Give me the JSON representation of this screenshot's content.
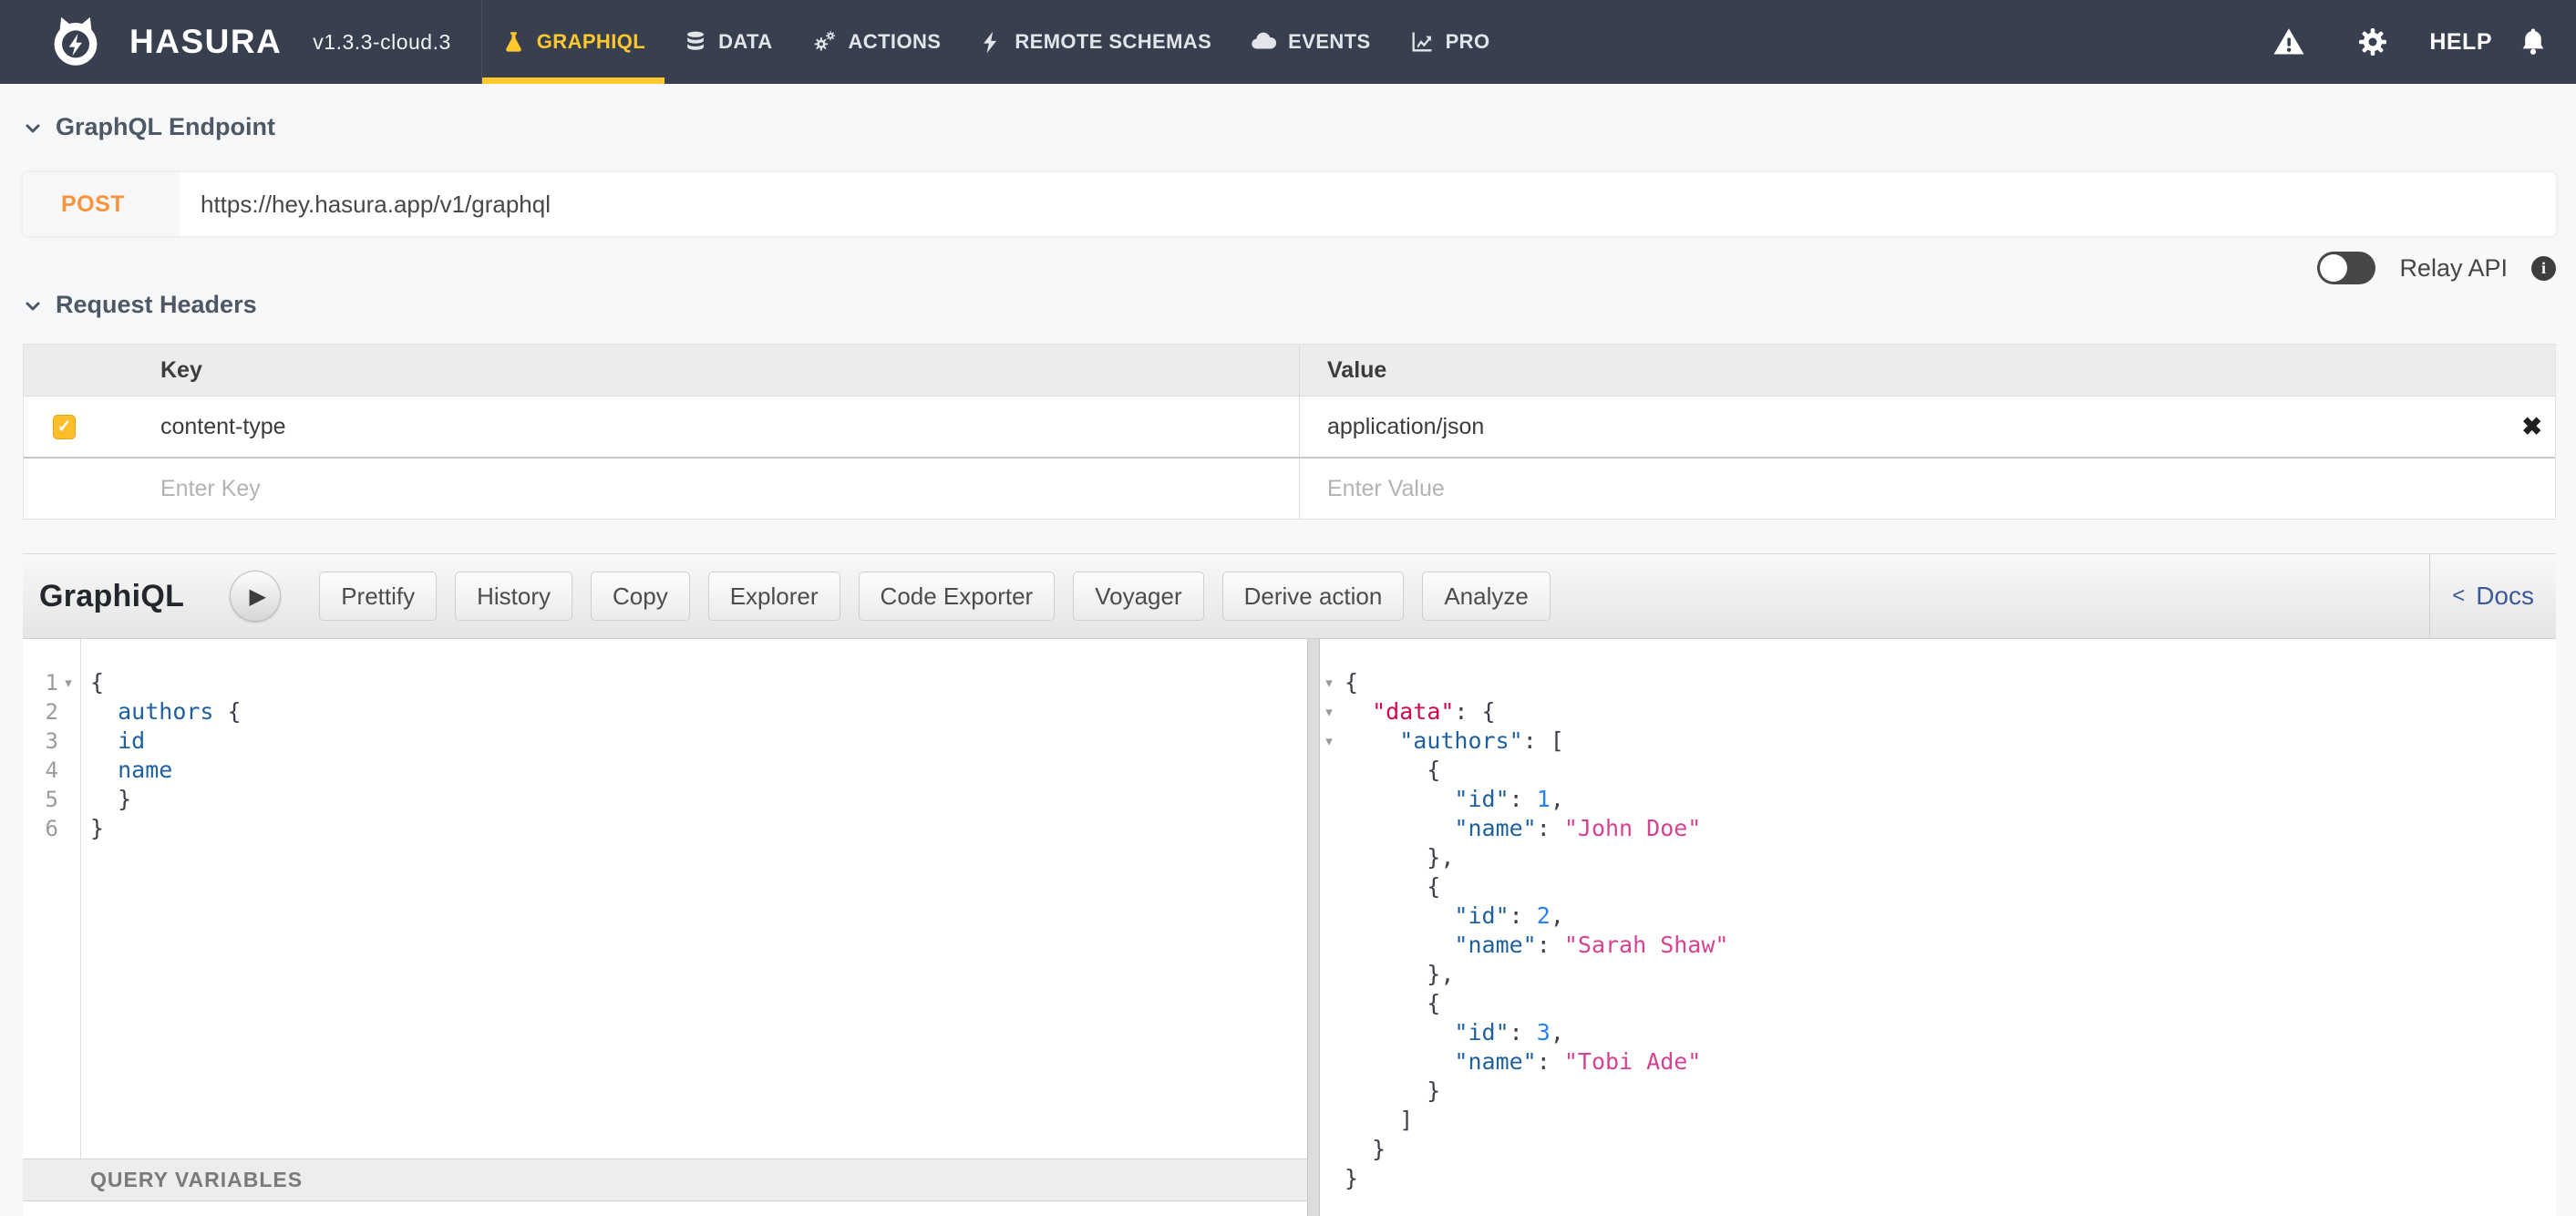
{
  "navbar": {
    "brand": "HASURA",
    "version": "v1.3.3-cloud.3",
    "tabs": [
      {
        "label": "GRAPHIQL",
        "icon": "flask-icon",
        "active": true
      },
      {
        "label": "DATA",
        "icon": "database-icon",
        "active": false
      },
      {
        "label": "ACTIONS",
        "icon": "cogs-icon",
        "active": false
      },
      {
        "label": "REMOTE SCHEMAS",
        "icon": "plug-icon",
        "active": false
      },
      {
        "label": "EVENTS",
        "icon": "cloud-icon",
        "active": false
      },
      {
        "label": "PRO",
        "icon": "chart-icon",
        "active": false
      }
    ],
    "help_label": "HELP"
  },
  "endpoint_section": {
    "title": "GraphQL Endpoint",
    "method": "POST",
    "url": "https://hey.hasura.app/v1/graphql",
    "relay_label": "Relay API"
  },
  "headers_section": {
    "title": "Request Headers",
    "col_key": "Key",
    "col_value": "Value",
    "rows": [
      {
        "enabled": true,
        "key": "content-type",
        "value": "application/json"
      }
    ],
    "key_placeholder": "Enter Key",
    "value_placeholder": "Enter Value"
  },
  "graphiql": {
    "title": "GraphiQL",
    "buttons": [
      "Prettify",
      "History",
      "Copy",
      "Explorer",
      "Code Exporter",
      "Voyager",
      "Derive action",
      "Analyze"
    ],
    "docs_label": "Docs",
    "query_variables_label": "QUERY VARIABLES",
    "query_lines": [
      {
        "n": 1,
        "fold": true,
        "t": [
          [
            "p",
            "{"
          ]
        ]
      },
      {
        "n": 2,
        "fold": false,
        "t": [
          [
            "p",
            "  "
          ],
          [
            "prop",
            "authors"
          ],
          [
            "p",
            " {"
          ]
        ]
      },
      {
        "n": 3,
        "fold": false,
        "t": [
          [
            "p",
            "  "
          ],
          [
            "prop",
            "id"
          ]
        ]
      },
      {
        "n": 4,
        "fold": false,
        "t": [
          [
            "p",
            "  "
          ],
          [
            "prop",
            "name"
          ]
        ]
      },
      {
        "n": 5,
        "fold": false,
        "t": [
          [
            "p",
            "  }"
          ]
        ]
      },
      {
        "n": 6,
        "fold": false,
        "t": [
          [
            "p",
            "}"
          ]
        ]
      }
    ],
    "response_lines": [
      {
        "fold": true,
        "t": [
          [
            "p",
            "{"
          ]
        ]
      },
      {
        "fold": true,
        "t": [
          [
            "p",
            "  "
          ],
          [
            "k",
            "\"data\""
          ],
          [
            "p",
            ": {"
          ]
        ]
      },
      {
        "fold": true,
        "t": [
          [
            "p",
            "    "
          ],
          [
            "prop",
            "\"authors\""
          ],
          [
            "p",
            ": ["
          ]
        ]
      },
      {
        "fold": false,
        "t": [
          [
            "p",
            "      {"
          ]
        ]
      },
      {
        "fold": false,
        "t": [
          [
            "p",
            "        "
          ],
          [
            "prop",
            "\"id\""
          ],
          [
            "p",
            ": "
          ],
          [
            "num",
            "1"
          ],
          [
            "p",
            ","
          ]
        ]
      },
      {
        "fold": false,
        "t": [
          [
            "p",
            "        "
          ],
          [
            "prop",
            "\"name\""
          ],
          [
            "p",
            ": "
          ],
          [
            "str",
            "\"John Doe\""
          ]
        ]
      },
      {
        "fold": false,
        "t": [
          [
            "p",
            "      },"
          ]
        ]
      },
      {
        "fold": false,
        "t": [
          [
            "p",
            "      {"
          ]
        ]
      },
      {
        "fold": false,
        "t": [
          [
            "p",
            "        "
          ],
          [
            "prop",
            "\"id\""
          ],
          [
            "p",
            ": "
          ],
          [
            "num",
            "2"
          ],
          [
            "p",
            ","
          ]
        ]
      },
      {
        "fold": false,
        "t": [
          [
            "p",
            "        "
          ],
          [
            "prop",
            "\"name\""
          ],
          [
            "p",
            ": "
          ],
          [
            "str",
            "\"Sarah Shaw\""
          ]
        ]
      },
      {
        "fold": false,
        "t": [
          [
            "p",
            "      },"
          ]
        ]
      },
      {
        "fold": false,
        "t": [
          [
            "p",
            "      {"
          ]
        ]
      },
      {
        "fold": false,
        "t": [
          [
            "p",
            "        "
          ],
          [
            "prop",
            "\"id\""
          ],
          [
            "p",
            ": "
          ],
          [
            "num",
            "3"
          ],
          [
            "p",
            ","
          ]
        ]
      },
      {
        "fold": false,
        "t": [
          [
            "p",
            "        "
          ],
          [
            "prop",
            "\"name\""
          ],
          [
            "p",
            ": "
          ],
          [
            "str",
            "\"Tobi Ade\""
          ]
        ]
      },
      {
        "fold": false,
        "t": [
          [
            "p",
            "      }"
          ]
        ]
      },
      {
        "fold": false,
        "t": [
          [
            "p",
            "    ]"
          ]
        ]
      },
      {
        "fold": false,
        "t": [
          [
            "p",
            "  }"
          ]
        ]
      },
      {
        "fold": false,
        "t": [
          [
            "p",
            "}"
          ]
        ]
      }
    ]
  },
  "colors": {
    "navbar_bg": "#384050",
    "accent_yellow": "#ffc82c",
    "method_orange": "#f9933e",
    "docs_blue": "#3b5998",
    "code_property_blue": "#1f61a0",
    "code_keyword_red": "#d2054e",
    "code_string_pink": "#d64292",
    "code_number_blue": "#2882f9"
  }
}
